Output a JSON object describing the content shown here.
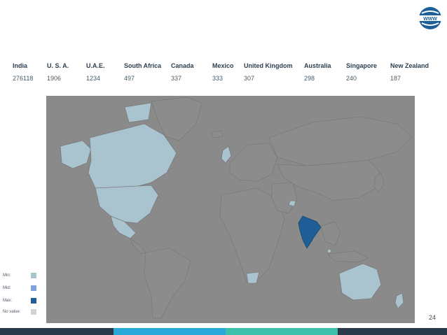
{
  "stats": [
    {
      "country": "India",
      "value": "276118"
    },
    {
      "country": "U. S. A.",
      "value": "1906"
    },
    {
      "country": "U.A.E.",
      "value": "1234"
    },
    {
      "country": "South Africa",
      "value": "497"
    },
    {
      "country": "Canada",
      "value": "337"
    },
    {
      "country": "Mexico",
      "value": "333"
    },
    {
      "country": "United Kingdom",
      "value": "307"
    },
    {
      "country": "Australia",
      "value": "298"
    },
    {
      "country": "Singapore",
      "value": "240"
    },
    {
      "country": "New Zealand",
      "value": "187"
    }
  ],
  "legend": [
    {
      "label": "Min:",
      "color": "#a9c4cf"
    },
    {
      "label": "Mid:",
      "color": "#7fa3db"
    },
    {
      "label": "Max:",
      "color": "#1f5d96"
    },
    {
      "label": "No value:",
      "color": "#d3d3d3"
    }
  ],
  "logo": {
    "text": "WWW",
    "color": "#1d5f98"
  },
  "page_number": "24",
  "colors": {
    "map_background": "#8a8a8a",
    "land_default": "#8c8c8c",
    "land_min": "#a9c4cf",
    "land_max": "#1f5d96",
    "bar_segments": [
      "#2b3a48",
      "#2aa8d8",
      "#3dbfaa",
      "#2b3a48"
    ]
  }
}
